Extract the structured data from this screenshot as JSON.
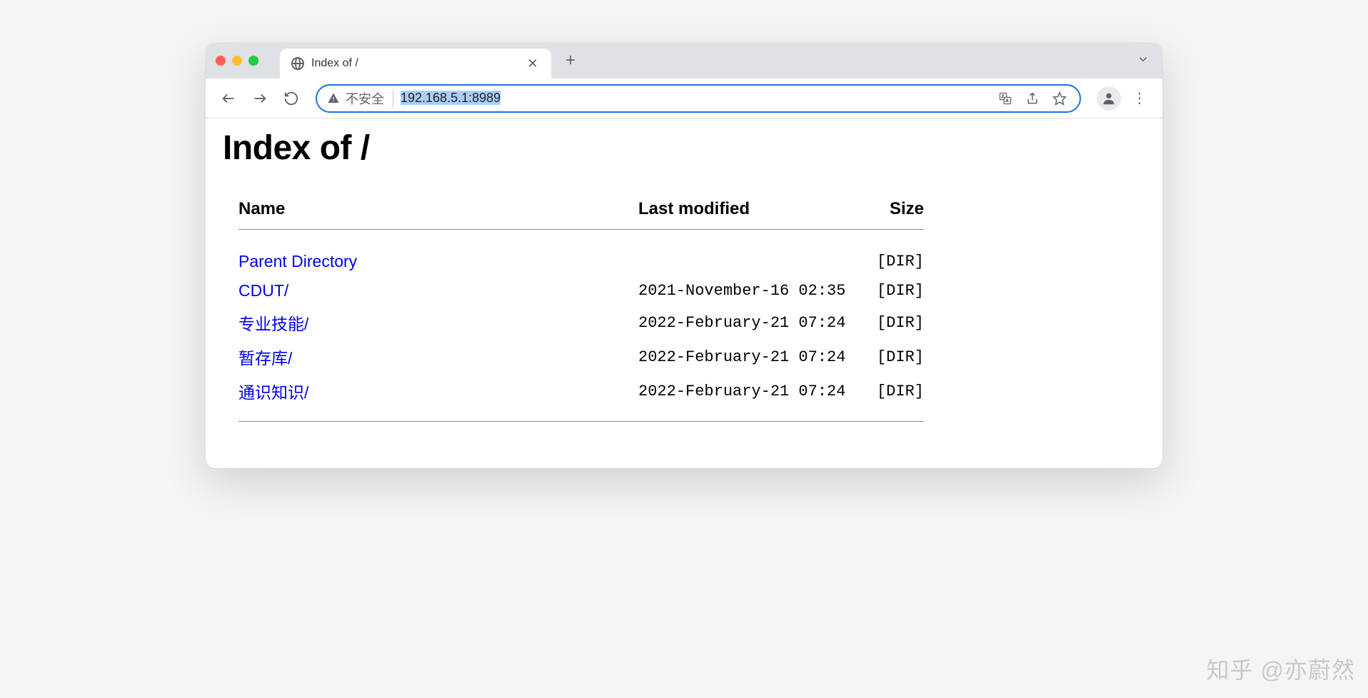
{
  "tab": {
    "title": "Index of /"
  },
  "addressBar": {
    "securityLabel": "不安全",
    "url": "192.168.5.1:8989"
  },
  "page": {
    "heading": "Index of /"
  },
  "columns": {
    "name": "Name",
    "modified": "Last modified",
    "size": "Size"
  },
  "rows": [
    {
      "name": "Parent Directory",
      "modified": "",
      "size": "[DIR]"
    },
    {
      "name": "CDUT/",
      "modified": "2021-November-16 02:35",
      "size": "[DIR]"
    },
    {
      "name": "专业技能/",
      "modified": "2022-February-21 07:24",
      "size": "[DIR]"
    },
    {
      "name": "暂存库/",
      "modified": "2022-February-21 07:24",
      "size": "[DIR]"
    },
    {
      "name": "通识知识/",
      "modified": "2022-February-21 07:24",
      "size": "[DIR]"
    }
  ],
  "watermark": "知乎 @亦蔚然"
}
